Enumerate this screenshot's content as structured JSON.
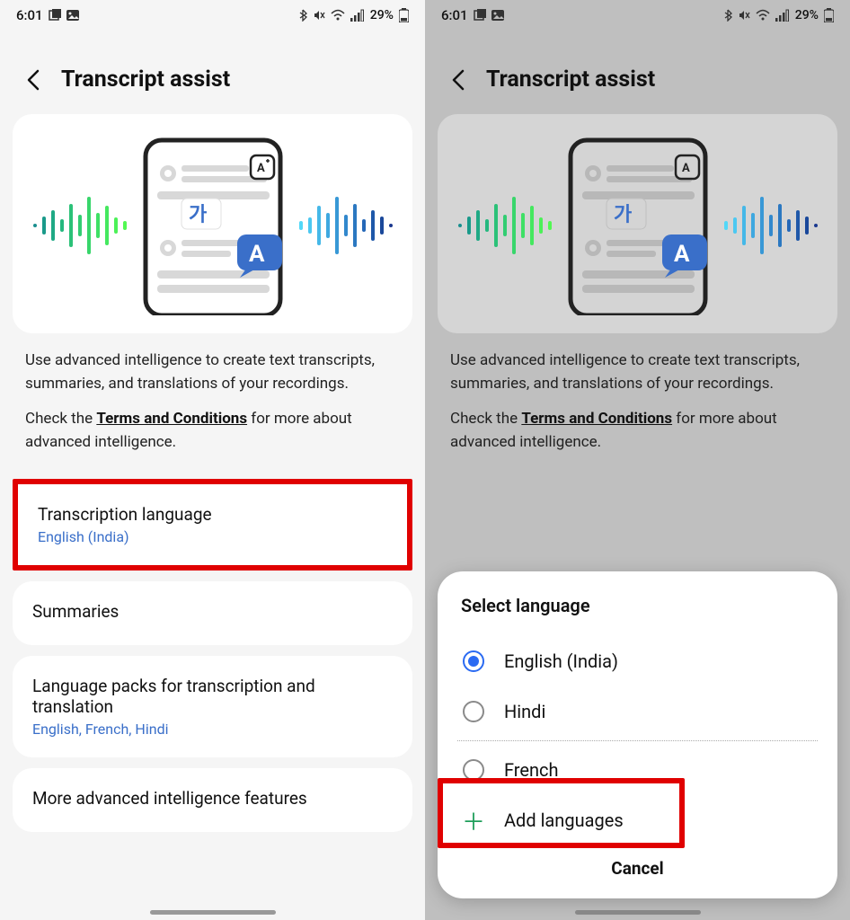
{
  "status": {
    "time": "6:01",
    "battery_text": "29%"
  },
  "header": {
    "title": "Transcript assist"
  },
  "hero": {
    "char1": "가",
    "char2": "A"
  },
  "desc": {
    "line1": "Use advanced intelligence to create text transcripts, summaries, and translations of your recordings.",
    "check_prefix": "Check the ",
    "terms_link": "Terms and Conditions",
    "check_suffix": " for more about advanced intelligence."
  },
  "items": {
    "transcription": {
      "title": "Transcription language",
      "sub": "English (India)"
    },
    "summaries": {
      "title": "Summaries"
    },
    "packs": {
      "title": "Language packs for transcription and translation",
      "sub": "English, French, Hindi"
    },
    "more": {
      "title": "More advanced intelligence features"
    }
  },
  "modal": {
    "title": "Select language",
    "options": [
      {
        "label": "English (India)",
        "selected": true
      },
      {
        "label": "Hindi",
        "selected": false
      },
      {
        "label": "French",
        "selected": false
      }
    ],
    "add_label": "Add languages",
    "cancel": "Cancel"
  }
}
